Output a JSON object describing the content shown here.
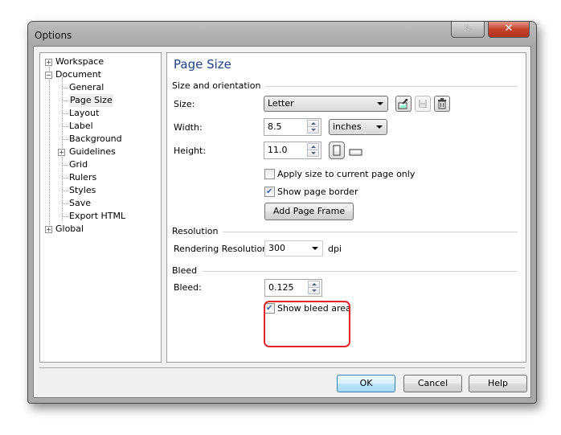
{
  "window": {
    "title": "Options",
    "pin_icon": "pin-icon",
    "close_icon": "close-icon"
  },
  "tree": {
    "items": [
      {
        "label": "Workspace",
        "expander": "+"
      },
      {
        "label": "Document",
        "expander": "−"
      },
      {
        "label": "General"
      },
      {
        "label": "Page Size",
        "selected": true
      },
      {
        "label": "Layout"
      },
      {
        "label": "Label"
      },
      {
        "label": "Background"
      },
      {
        "label": "Guidelines",
        "expander": "+"
      },
      {
        "label": "Grid"
      },
      {
        "label": "Rulers"
      },
      {
        "label": "Styles"
      },
      {
        "label": "Save"
      },
      {
        "label": "Export HTML"
      },
      {
        "label": "Global",
        "expander": "+"
      }
    ]
  },
  "panel": {
    "title": "Page Size",
    "size_orientation": {
      "group_label": "Size and orientation",
      "size_label": "Size:",
      "size_value": "Letter",
      "width_label": "Width:",
      "width_value": "8.5",
      "units_value": "inches",
      "height_label": "Height:",
      "height_value": "11.0",
      "orientation": "portrait",
      "apply_current_label": "Apply size to current page only",
      "apply_current_checked": false,
      "show_border_label": "Show page border",
      "show_border_checked": true,
      "add_frame_label": "Add Page Frame"
    },
    "resolution": {
      "group_label": "Resolution",
      "rendering_label": "Rendering Resolution:",
      "rendering_value": "300",
      "unit": "dpi"
    },
    "bleed": {
      "group_label": "Bleed",
      "bleed_label": "Bleed:",
      "bleed_value": "0.125",
      "show_bleed_label": "Show bleed area",
      "show_bleed_checked": true
    }
  },
  "footer": {
    "ok_label": "OK",
    "cancel_label": "Cancel",
    "help_label": "Help"
  },
  "colors": {
    "title_accent": "#1e3f8a",
    "highlight": "#e3262a",
    "close_button": "#c5412b"
  }
}
